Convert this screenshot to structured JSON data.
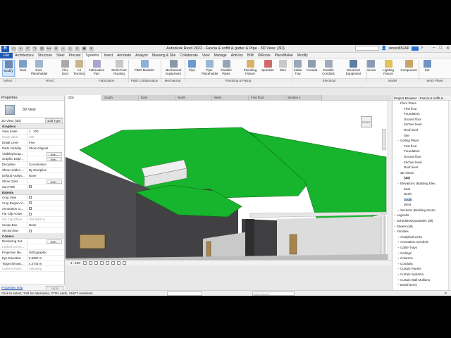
{
  "window": {
    "title": "Autodesk Revit 2022 - Fascia & soffit & gutter & Pipe - 3D View: {3D}",
    "user": "simoni852AP"
  },
  "tabs": [
    "File",
    "Architecture",
    "Structure",
    "Steel",
    "Precast",
    "Systems",
    "Insert",
    "Annotate",
    "Analyze",
    "Massing & Site",
    "Collaborate",
    "View",
    "Manage",
    "Add-Ins",
    "BIM",
    "DiRoots",
    "PlaceMaker",
    "Modify"
  ],
  "ribbon": {
    "tools": [
      {
        "label": "Modify",
        "color": "#6d88b3"
      },
      {
        "label": "Duct",
        "color": "#7aa0c8"
      },
      {
        "label": "Duct Placeholder",
        "color": "#9fb6cf"
      },
      {
        "label": "Flex Duct",
        "color": "#a9a9a9"
      },
      {
        "label": "Air Terminal",
        "color": "#c7b58e"
      },
      {
        "label": "Fabrication Part",
        "color": "#a7a7c9"
      },
      {
        "label": "Multi-Point Routing",
        "color": "#c8c8c8"
      },
      {
        "label": "P&ID Modeler",
        "color": "#8fb0d9"
      },
      {
        "label": "Mechanical Equipment",
        "color": "#8c96a8"
      },
      {
        "label": "Pipe",
        "color": "#6d9bcf"
      },
      {
        "label": "Pipe Placeholder",
        "color": "#9db8d6"
      },
      {
        "label": "Parallel Pipes",
        "color": "#98a3b8"
      },
      {
        "label": "Plumbing Fixture",
        "color": "#d6b36a"
      },
      {
        "label": "Sprinkler",
        "color": "#d06a6a"
      },
      {
        "label": "Wire",
        "color": "#c8c8c8"
      },
      {
        "label": "Cable Tray",
        "color": "#9aa8b8"
      },
      {
        "label": "Conduit",
        "color": "#8f9fb0"
      },
      {
        "label": "Parallel Conduits",
        "color": "#a0acbc"
      },
      {
        "label": "Electrical Equipment",
        "color": "#5e7ea6"
      },
      {
        "label": "Device",
        "color": "#8a9cb3"
      },
      {
        "label": "Lighting Fixture",
        "color": "#e0c25a"
      },
      {
        "label": "Component",
        "color": "#c9a46b"
      },
      {
        "label": "Set",
        "color": "#6f93c4"
      }
    ],
    "panels": [
      "Select",
      "HVAC",
      "Fabrication",
      "P&ID Collaboration",
      "Mechanical",
      "Plumbing & Piping",
      "Electrical",
      "Model",
      "Work Plane"
    ]
  },
  "properties": {
    "title": "Properties",
    "type_name": "3D View",
    "selector": "3D View: {3D}",
    "edit_type": "Edit Type",
    "help_link": "Properties help",
    "apply": "Apply",
    "groups": [
      {
        "name": "Graphics",
        "rows": [
          {
            "k": "View Scale",
            "v": "1 : 100"
          },
          {
            "k": "Scale Value",
            "v": "100",
            "greyed": true
          },
          {
            "k": "Detail Level",
            "v": "Fine"
          },
          {
            "k": "Parts Visibility",
            "v": "Show Original"
          },
          {
            "k": "Visibility/Grap...",
            "v": "",
            "btn": "Edit..."
          },
          {
            "k": "Graphic Displ...",
            "v": "",
            "btn": "Edit..."
          },
          {
            "k": "Discipline",
            "v": "Coordination"
          },
          {
            "k": "Show Hidden ...",
            "v": "By Discipline"
          },
          {
            "k": "Default Analys...",
            "v": "None"
          },
          {
            "k": "Show Grids",
            "v": "",
            "btn": "Edit..."
          },
          {
            "k": "Sun Path",
            "v": "",
            "check": false
          }
        ]
      },
      {
        "name": "Extents",
        "rows": [
          {
            "k": "Crop View",
            "v": "",
            "check": false
          },
          {
            "k": "Crop Region Vi...",
            "v": "",
            "check": false
          },
          {
            "k": "Annotation Cr...",
            "v": "",
            "check": false
          },
          {
            "k": "Far Clip Active",
            "v": "",
            "check": false
          },
          {
            "k": "Far Clip Offset",
            "v": "304.8000 m",
            "greyed": true
          },
          {
            "k": "Scope Box",
            "v": "None"
          },
          {
            "k": "Section Box",
            "v": "",
            "check": false
          }
        ]
      },
      {
        "name": "Camera",
        "rows": [
          {
            "k": "Rendering Set...",
            "v": "",
            "btn": "Edit..."
          },
          {
            "k": "Locked Orient...",
            "v": "",
            "greyed": true
          },
          {
            "k": "Projection Mo...",
            "v": "Orthographic"
          },
          {
            "k": "Eye Elevation",
            "v": "6.6687 m"
          },
          {
            "k": "Target Elevati...",
            "v": "4.4743 m"
          },
          {
            "k": "Camera Posit...",
            "v": "Adjusting",
            "greyed": true
          }
        ]
      }
    ]
  },
  "view_tabs": [
    "{3D}",
    "South",
    "East",
    "North",
    "West",
    "First floor",
    "Section 1"
  ],
  "view_control": {
    "scale": "1 : 100"
  },
  "viewcube_label": "FRONT",
  "colors": {
    "roof": "#17b52d",
    "wall": "#4c4c4e",
    "wall_light": "#dcdcdc"
  },
  "browser": {
    "title": "Project Browser - Fascia & soffit &...",
    "nodes": [
      {
        "d": 1,
        "t": "-",
        "l": "Floor Plans"
      },
      {
        "d": 2,
        "l": "First floor"
      },
      {
        "d": 2,
        "l": "Foundation"
      },
      {
        "d": 2,
        "l": "Ground floor"
      },
      {
        "d": 2,
        "l": "Kitchen level"
      },
      {
        "d": 2,
        "l": "Roof level"
      },
      {
        "d": 2,
        "l": "Site"
      },
      {
        "d": 1,
        "t": "-",
        "l": "Ceiling Plans"
      },
      {
        "d": 2,
        "l": "First floor"
      },
      {
        "d": 2,
        "l": "Foundation"
      },
      {
        "d": 2,
        "l": "Ground floor"
      },
      {
        "d": 2,
        "l": "Kitchen level"
      },
      {
        "d": 2,
        "l": "Roof level"
      },
      {
        "d": 1,
        "t": "-",
        "l": "3D Views"
      },
      {
        "d": 2,
        "l": "{3D}",
        "bold": true
      },
      {
        "d": 1,
        "t": "-",
        "l": "Elevations (Building Elev"
      },
      {
        "d": 2,
        "l": "East"
      },
      {
        "d": 2,
        "l": "North"
      },
      {
        "d": 2,
        "l": "South",
        "sel": true
      },
      {
        "d": 2,
        "l": "West"
      },
      {
        "d": 1,
        "t": "+",
        "l": "Sections (Building Sectio"
      },
      {
        "d": 0,
        "t": "+",
        "l": "Legends"
      },
      {
        "d": 0,
        "t": "+",
        "l": "Schedules/Quantities (all)"
      },
      {
        "d": 0,
        "t": "+",
        "l": "Sheets (all)"
      },
      {
        "d": 0,
        "t": "-",
        "l": "Families"
      },
      {
        "d": 1,
        "t": "+",
        "l": "Analytical Links"
      },
      {
        "d": 1,
        "t": "+",
        "l": "Annotation Symbols"
      },
      {
        "d": 1,
        "t": "+",
        "l": "Cable Trays"
      },
      {
        "d": 1,
        "t": "+",
        "l": "Ceilings"
      },
      {
        "d": 1,
        "t": "+",
        "l": "Columns"
      },
      {
        "d": 1,
        "t": "+",
        "l": "Conduits"
      },
      {
        "d": 1,
        "t": "+",
        "l": "Curtain Panels"
      },
      {
        "d": 1,
        "t": "+",
        "l": "Curtain Systems"
      },
      {
        "d": 1,
        "t": "+",
        "l": "Curtain Wall Mullions"
      },
      {
        "d": 1,
        "t": "+",
        "l": "Detail Items"
      }
    ]
  },
  "status": {
    "text": "Click to select, TAB for alternates, CTRL adds, SHIFT unselects.",
    "model": "Main Model",
    "count": ":0"
  }
}
